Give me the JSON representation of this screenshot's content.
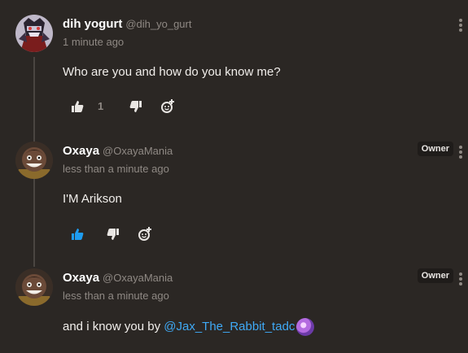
{
  "comments": [
    {
      "name": "dih yogurt",
      "handle": "@dih_yo_gurt",
      "time": "1 minute ago",
      "text": "Who are you and how do you know me?",
      "likes": "1"
    },
    {
      "name": "Oxaya",
      "handle": "@OxayaMania",
      "badge": "Owner",
      "time": "less than a minute ago",
      "text": "I'M Arikson"
    },
    {
      "name": "Oxaya",
      "handle": "@OxayaMania",
      "badge": "Owner",
      "time": "less than a minute ago",
      "text_prefix": "and i know you by ",
      "mention": "@Jax_The_Rabbit_tadc"
    }
  ],
  "colors": {
    "background": "#2b2724",
    "liked_blue": "#1e9cf0",
    "mention_blue": "#3fa9f5",
    "muted": "#8f8984"
  },
  "icons": [
    "thumbs-up-icon",
    "thumbs-down-icon",
    "add-reaction-icon",
    "more-options-icon"
  ]
}
